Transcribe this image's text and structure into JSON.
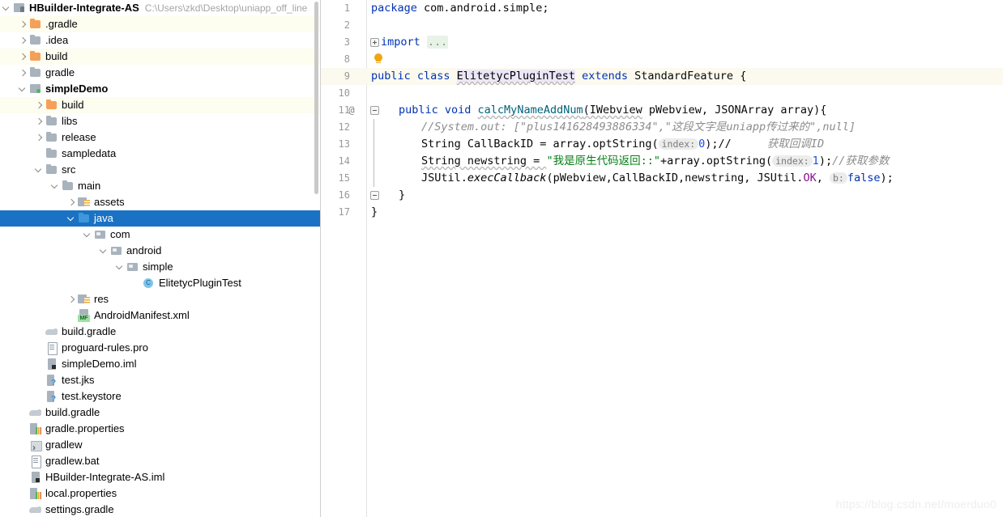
{
  "project_panel": {
    "root": {
      "label": "HBuilder-Integrate-AS",
      "path": "C:\\Users\\zkd\\Desktop\\uniapp_off_line"
    },
    "scrollbar": {
      "name": "project-scrollbar"
    },
    "items": [
      {
        "label": ".gradle",
        "indent": 1,
        "arrow": "collapsed",
        "icon": "folder-orange-icon",
        "stripe": true,
        "selected": false,
        "bold": false
      },
      {
        "label": ".idea",
        "indent": 1,
        "arrow": "collapsed",
        "icon": "folder-icon",
        "stripe": false,
        "selected": false,
        "bold": false
      },
      {
        "label": "build",
        "indent": 1,
        "arrow": "collapsed",
        "icon": "folder-orange-icon",
        "stripe": true,
        "selected": false,
        "bold": false
      },
      {
        "label": "gradle",
        "indent": 1,
        "arrow": "collapsed",
        "icon": "folder-icon",
        "stripe": false,
        "selected": false,
        "bold": false
      },
      {
        "label": "simpleDemo",
        "indent": 1,
        "arrow": "expanded",
        "icon": "module-icon",
        "stripe": false,
        "selected": false,
        "bold": true
      },
      {
        "label": "build",
        "indent": 2,
        "arrow": "collapsed",
        "icon": "folder-orange-icon",
        "stripe": true,
        "selected": false,
        "bold": false
      },
      {
        "label": "libs",
        "indent": 2,
        "arrow": "collapsed",
        "icon": "folder-icon",
        "stripe": false,
        "selected": false,
        "bold": false
      },
      {
        "label": "release",
        "indent": 2,
        "arrow": "collapsed",
        "icon": "folder-icon",
        "stripe": false,
        "selected": false,
        "bold": false
      },
      {
        "label": "sampledata",
        "indent": 2,
        "arrow": "none",
        "icon": "folder-icon",
        "stripe": false,
        "selected": false,
        "bold": false
      },
      {
        "label": "src",
        "indent": 2,
        "arrow": "expanded",
        "icon": "folder-icon",
        "stripe": false,
        "selected": false,
        "bold": false
      },
      {
        "label": "main",
        "indent": 3,
        "arrow": "expanded",
        "icon": "folder-icon",
        "stripe": false,
        "selected": false,
        "bold": false
      },
      {
        "label": "assets",
        "indent": 4,
        "arrow": "collapsed",
        "icon": "res-folder-icon",
        "stripe": false,
        "selected": false,
        "bold": false
      },
      {
        "label": "java",
        "indent": 4,
        "arrow": "expanded",
        "icon": "folder-blue-icon",
        "stripe": false,
        "selected": true,
        "bold": false
      },
      {
        "label": "com",
        "indent": 5,
        "arrow": "expanded",
        "icon": "package-icon",
        "stripe": false,
        "selected": false,
        "bold": false
      },
      {
        "label": "android",
        "indent": 6,
        "arrow": "expanded",
        "icon": "package-icon",
        "stripe": false,
        "selected": false,
        "bold": false
      },
      {
        "label": "simple",
        "indent": 7,
        "arrow": "expanded",
        "icon": "package-icon",
        "stripe": false,
        "selected": false,
        "bold": false
      },
      {
        "label": "ElitetycPluginTest",
        "indent": 8,
        "arrow": "none",
        "icon": "java-class-icon",
        "stripe": false,
        "selected": false,
        "bold": false
      },
      {
        "label": "res",
        "indent": 4,
        "arrow": "collapsed",
        "icon": "res-folder-icon",
        "stripe": false,
        "selected": false,
        "bold": false
      },
      {
        "label": "AndroidManifest.xml",
        "indent": 4,
        "arrow": "none",
        "icon": "manifest-icon",
        "stripe": false,
        "selected": false,
        "bold": false
      },
      {
        "label": "build.gradle",
        "indent": 2,
        "arrow": "none",
        "icon": "gradle-icon",
        "stripe": false,
        "selected": false,
        "bold": false
      },
      {
        "label": "proguard-rules.pro",
        "indent": 2,
        "arrow": "none",
        "icon": "text-file-icon",
        "stripe": false,
        "selected": false,
        "bold": false
      },
      {
        "label": "simpleDemo.iml",
        "indent": 2,
        "arrow": "none",
        "icon": "iml-file-icon",
        "stripe": false,
        "selected": false,
        "bold": false
      },
      {
        "label": "test.jks",
        "indent": 2,
        "arrow": "none",
        "icon": "unknown-file-icon",
        "stripe": false,
        "selected": false,
        "bold": false
      },
      {
        "label": "test.keystore",
        "indent": 2,
        "arrow": "none",
        "icon": "unknown-file-icon",
        "stripe": false,
        "selected": false,
        "bold": false
      },
      {
        "label": "build.gradle",
        "indent": 1,
        "arrow": "none",
        "icon": "gradle-icon",
        "stripe": false,
        "selected": false,
        "bold": false
      },
      {
        "label": "gradle.properties",
        "indent": 1,
        "arrow": "none",
        "icon": "properties-file-icon",
        "stripe": false,
        "selected": false,
        "bold": false
      },
      {
        "label": "gradlew",
        "indent": 1,
        "arrow": "none",
        "icon": "script-file-icon",
        "stripe": false,
        "selected": false,
        "bold": false
      },
      {
        "label": "gradlew.bat",
        "indent": 1,
        "arrow": "none",
        "icon": "text-file-icon",
        "stripe": false,
        "selected": false,
        "bold": false
      },
      {
        "label": "HBuilder-Integrate-AS.iml",
        "indent": 1,
        "arrow": "none",
        "icon": "iml-file-icon",
        "stripe": false,
        "selected": false,
        "bold": false
      },
      {
        "label": "local.properties",
        "indent": 1,
        "arrow": "none",
        "icon": "properties-file-icon",
        "stripe": false,
        "selected": false,
        "bold": false
      },
      {
        "label": "settings.gradle",
        "indent": 1,
        "arrow": "none",
        "icon": "gradle-icon",
        "stripe": false,
        "selected": false,
        "bold": false
      }
    ]
  },
  "editor": {
    "lines": [
      {
        "num": "1",
        "caret": false,
        "gutter": "",
        "at": false
      },
      {
        "num": "2",
        "caret": false,
        "gutter": "",
        "at": false
      },
      {
        "num": "3",
        "caret": false,
        "gutter": "fold-plus",
        "at": false
      },
      {
        "num": "8",
        "caret": false,
        "gutter": "bulb",
        "at": false
      },
      {
        "num": "9",
        "caret": true,
        "gutter": "",
        "at": false
      },
      {
        "num": "10",
        "caret": false,
        "gutter": "",
        "at": false
      },
      {
        "num": "11",
        "caret": false,
        "gutter": "fold-open",
        "at": true
      },
      {
        "num": "12",
        "caret": false,
        "gutter": "",
        "at": false
      },
      {
        "num": "13",
        "caret": false,
        "gutter": "",
        "at": false
      },
      {
        "num": "14",
        "caret": false,
        "gutter": "",
        "at": false
      },
      {
        "num": "15",
        "caret": false,
        "gutter": "",
        "at": false
      },
      {
        "num": "16",
        "caret": false,
        "gutter": "fold-close",
        "at": false
      },
      {
        "num": "17",
        "caret": false,
        "gutter": "",
        "at": false
      }
    ],
    "code": {
      "l1_kw": "package",
      "l1_pkg": " com.android.simple;",
      "l3_kw": "import",
      "l3_fold": "...",
      "l9_a": "public class ",
      "l9_class": "ElitetycPluginTest",
      "l9_b": " extends ",
      "l9_super": "StandardFeature",
      "l9_c": " {",
      "l11_mods": "public void ",
      "l11_name": "calcMyNameAddNum",
      "l11_params_a": "(IWebview",
      "l11_params_b": " pWebview, JSONArray array){",
      "l12_comment": "//System.out: [\"plus141628493886334\",\"这段文字是uniapp传过来的\",null]",
      "l13_a": "String CallBackID = array.optString(",
      "l13_hint": "index:",
      "l13_num": "0",
      "l13_b": ");//",
      "l13_trailing": "获取回调ID",
      "l14_a": "String newstring = ",
      "l14_str": "\"我是原生代码返回::\"",
      "l14_b": "+array.optString(",
      "l14_hint": "index:",
      "l14_num": "1",
      "l14_c": ");",
      "l14_comment": "//获取参数",
      "l15_cls": "JSUtil.",
      "l15_meth": "execCallback",
      "l15_a": "(pWebview,CallBackID,newstring, JSUtil.",
      "l15_ok": "OK",
      "l15_b": ", ",
      "l15_hint": "b:",
      "l15_false": "false",
      "l15_c": ");",
      "l16_brace": "}",
      "l17_brace": "}"
    }
  },
  "watermark": {
    "text": "https://blog.csdn.net/moerduo0"
  },
  "colors": {
    "selection": "#1a72c4",
    "stripe": "#fdfdf0",
    "caret_row": "#fcfaef",
    "keyword": "#0033b3",
    "string": "#067d17",
    "number": "#1750eb",
    "comment": "#8c8c8c",
    "method": "#00627a",
    "field": "#871094",
    "class_highlight": "#ece7f7",
    "bulb": "#f0a515"
  }
}
